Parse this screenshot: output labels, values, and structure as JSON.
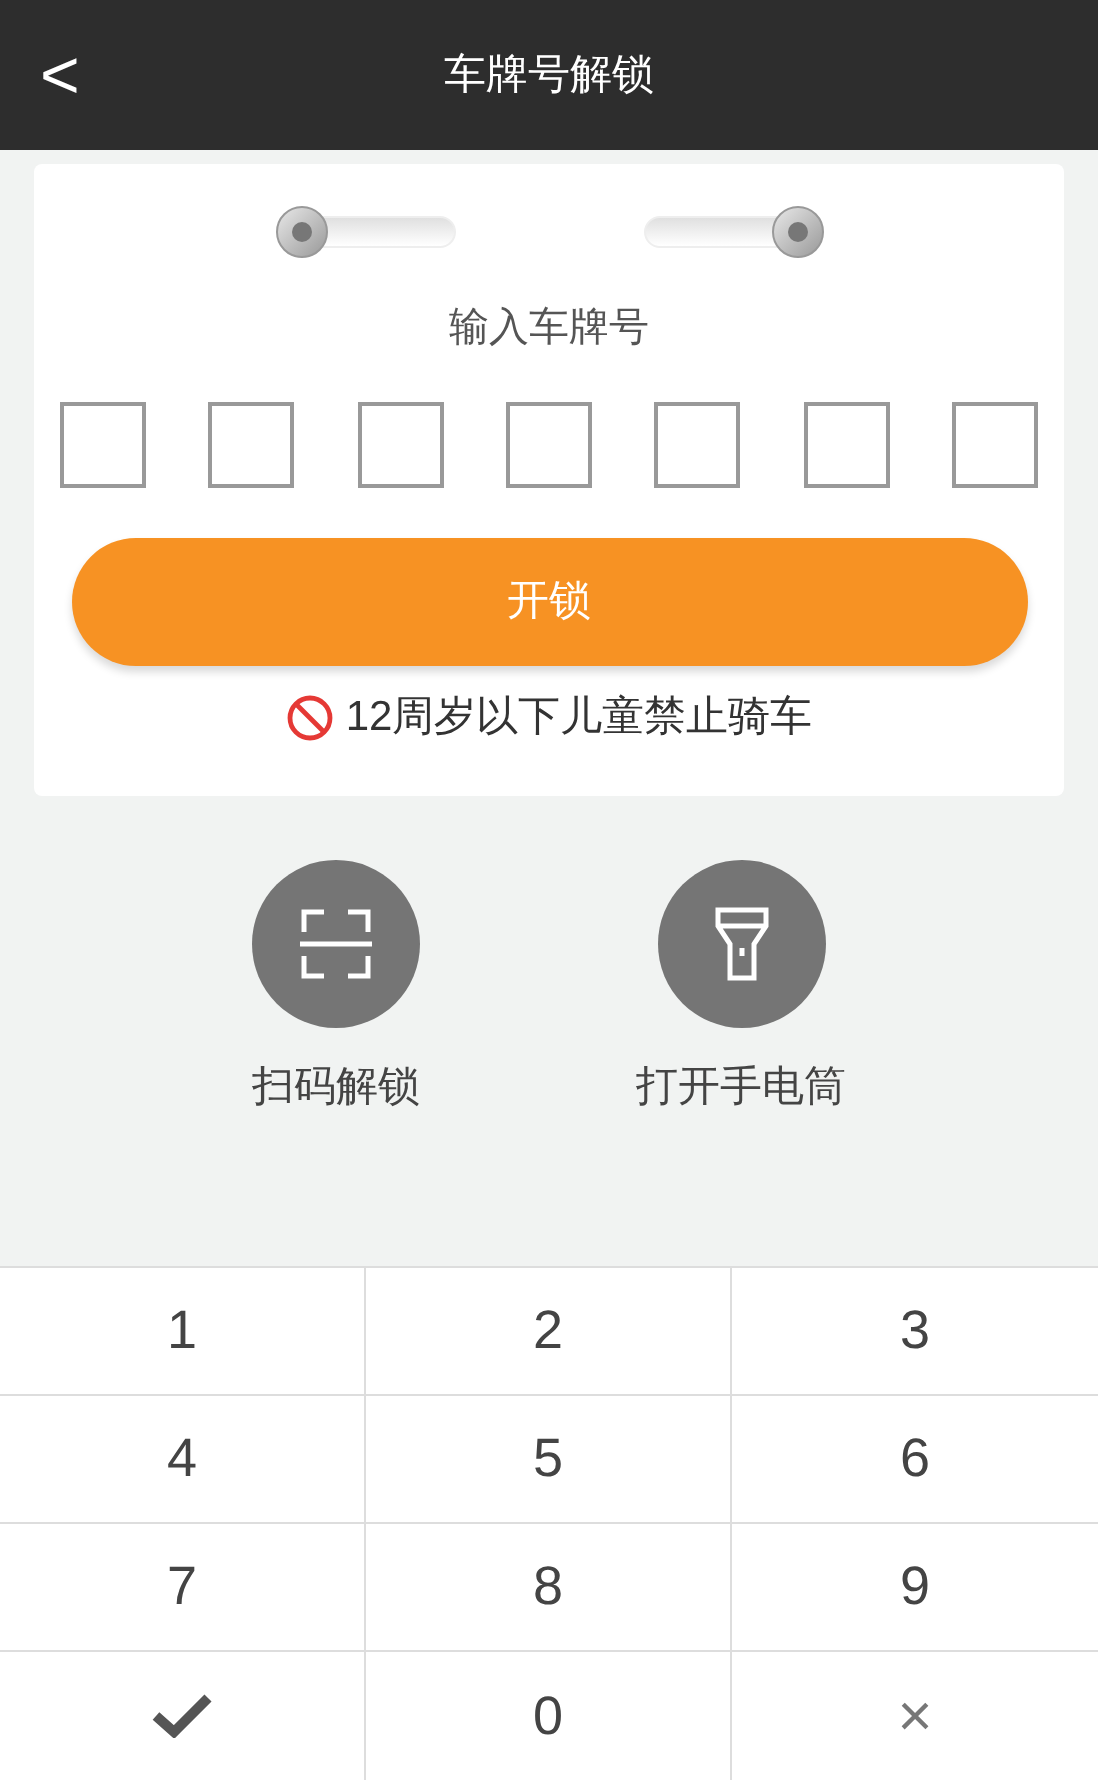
{
  "header": {
    "back": "<",
    "title": "车牌号解锁"
  },
  "switches": [
    {
      "on": false
    },
    {
      "on": true
    }
  ],
  "prompt": "输入车牌号",
  "plate_boxes": [
    {
      "filled": false
    },
    {
      "filled": false
    },
    {
      "filled": false
    },
    {
      "filled": false
    },
    {
      "filled": false
    },
    {
      "filled": false
    },
    {
      "filled": false
    }
  ],
  "unlock_button": "开锁",
  "warning": "12周岁以下儿童禁止骑车",
  "actions": [
    {
      "kind": "scan",
      "label": "扫码解锁"
    },
    {
      "kind": "flashlight",
      "label": "打开手电筒"
    }
  ],
  "keypad": [
    {
      "kind": "digit",
      "label": "1"
    },
    {
      "kind": "digit",
      "label": "2"
    },
    {
      "kind": "digit",
      "label": "3"
    },
    {
      "kind": "digit",
      "label": "4"
    },
    {
      "kind": "digit",
      "label": "5"
    },
    {
      "kind": "digit",
      "label": "6"
    },
    {
      "kind": "digit",
      "label": "7"
    },
    {
      "kind": "digit",
      "label": "8"
    },
    {
      "kind": "digit",
      "label": "9"
    },
    {
      "kind": "confirm"
    },
    {
      "kind": "digit",
      "label": "0"
    },
    {
      "kind": "delete",
      "label": "×"
    }
  ]
}
